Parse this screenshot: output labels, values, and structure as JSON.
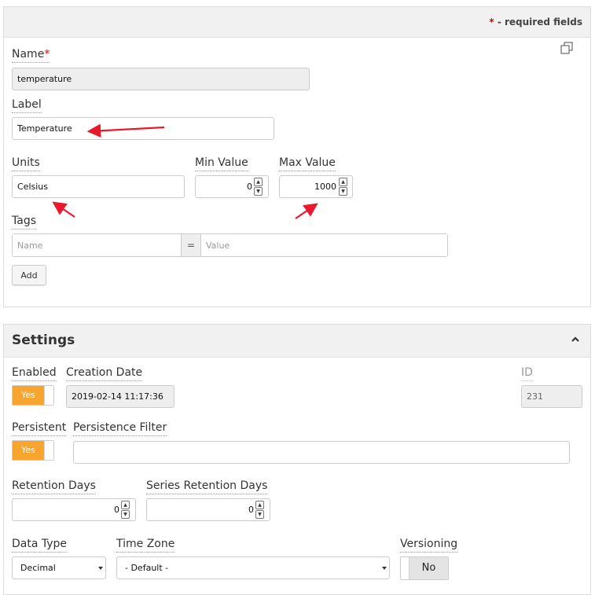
{
  "form": {
    "required_note": {
      "star": "*",
      "text": " - required fields"
    },
    "name": {
      "label": "Name",
      "star": "*",
      "value": "temperature"
    },
    "label": {
      "label": "Label",
      "value": "Temperature"
    },
    "units": {
      "label": "Units",
      "value": "Celsius"
    },
    "min_value": {
      "label": "Min Value",
      "value": "0"
    },
    "max_value": {
      "label": "Max Value",
      "value": "1000"
    },
    "tags": {
      "label": "Tags",
      "name_placeholder": "Name",
      "separator": "=",
      "value_placeholder": "Value",
      "add_label": "Add"
    }
  },
  "settings": {
    "title": "Settings",
    "enabled": {
      "label": "Enabled",
      "value": "Yes"
    },
    "creation_date": {
      "label": "Creation Date",
      "value": "2019-02-14 11:17:36"
    },
    "id": {
      "label": "ID",
      "value": "231"
    },
    "persistent": {
      "label": "Persistent",
      "value": "Yes"
    },
    "persistence_filter": {
      "label": "Persistence Filter",
      "value": ""
    },
    "retention_days": {
      "label": "Retention Days",
      "value": "0"
    },
    "series_retention_days": {
      "label": "Series Retention Days",
      "value": "0"
    },
    "data_type": {
      "label": "Data Type",
      "value": "Decimal"
    },
    "time_zone": {
      "label": "Time Zone",
      "value": "- Default -"
    },
    "versioning": {
      "label": "Versioning",
      "value": "No"
    }
  },
  "icons": {
    "copy": "copy-icon",
    "collapse": "chevron-up-icon",
    "spinner_up": "up",
    "spinner_down": "down"
  },
  "colors": {
    "accent": "#f7a52e",
    "annotation_arrow": "#e8192c",
    "required": "#e00000"
  }
}
